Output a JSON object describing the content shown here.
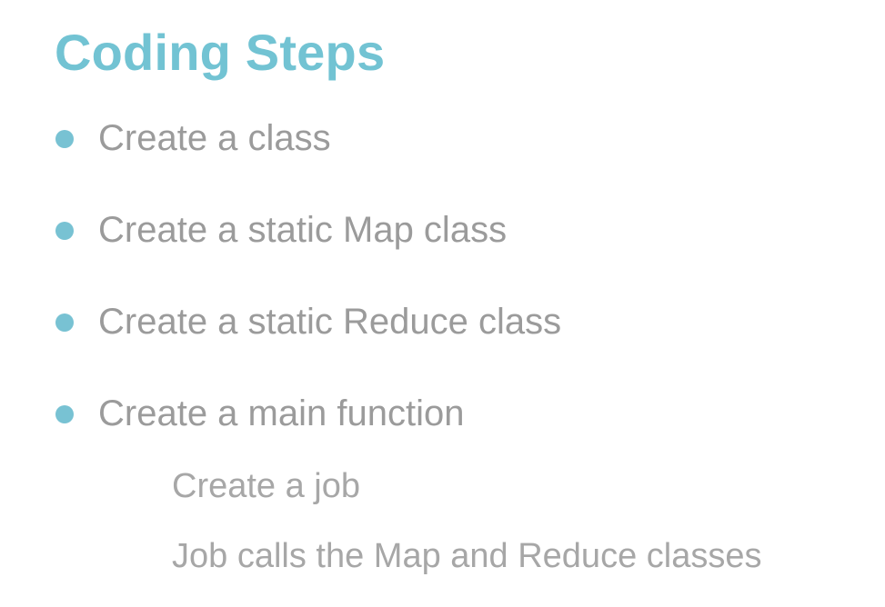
{
  "colors": {
    "accent": "#72c3d3",
    "bullet": "#78c2d3",
    "text": "#9b9b9b",
    "subtext": "#a7a7a7"
  },
  "slide": {
    "title": "Coding Steps",
    "bullets": [
      "Create a class",
      "Create a static Map class",
      "Create a static Reduce class",
      "Create a main function"
    ],
    "subitems": [
      "Create a job",
      "Job calls the Map and Reduce classes"
    ]
  }
}
